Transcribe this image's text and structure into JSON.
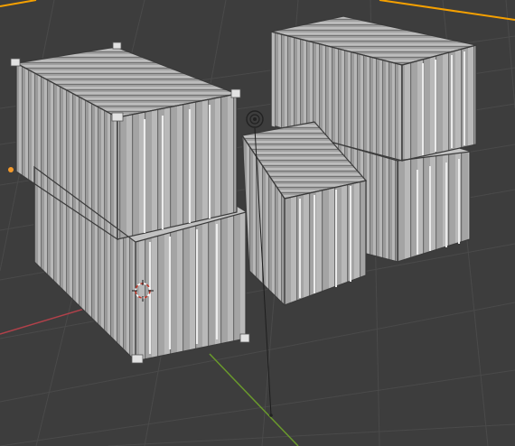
{
  "viewport": {
    "mode": "Solid",
    "objects": [
      "container-stack-left",
      "container-stack-right",
      "container-small-front"
    ],
    "colors": {
      "background": "#3d3d3d",
      "grid": "#4a4a4a",
      "x_axis": "#b1414a",
      "y_axis": "#6a9a2c",
      "selection": "#f5a000",
      "container": "#a6a6a6"
    },
    "icons": [
      "3d-cursor-icon",
      "light-object-icon",
      "origin-dot-icon"
    ]
  }
}
